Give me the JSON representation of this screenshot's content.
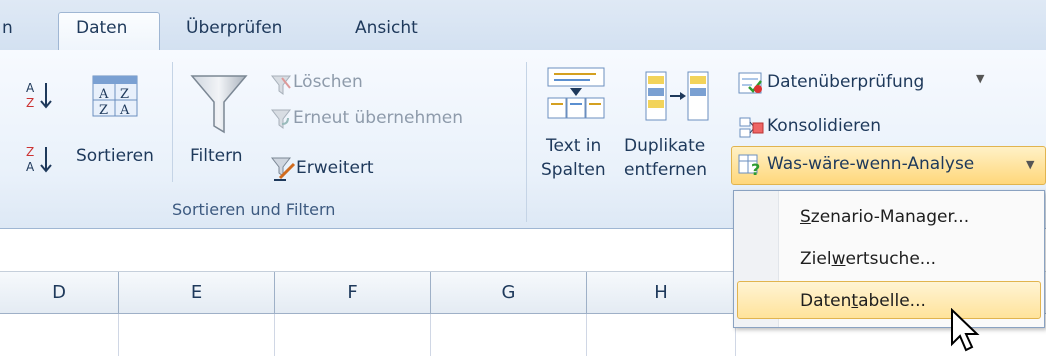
{
  "tabs": {
    "partial": "n",
    "daten": "Daten",
    "ueberpruefen": "Überprüfen",
    "ansicht": "Ansicht"
  },
  "ribbon": {
    "sort_az_glyph": "A↓\nZ",
    "sortieren_label": "Sortieren",
    "filtern_label": "Filtern",
    "loeschen_label": "Löschen",
    "erneut_label": "Erneut übernehmen",
    "erweitert_label": "Erweitert",
    "group_sort_filter": "Sortieren und Filtern",
    "text_in_spalten_line1": "Text in",
    "text_in_spalten_line2": "Spalten",
    "duplikate_line1": "Duplikate",
    "duplikate_line2": "entfernen",
    "datenueberpruefung_label": "Datenüberprüfung",
    "konsolidieren_label": "Konsolidieren",
    "was_waere_wenn_label": "Was-wäre-wenn-Analyse"
  },
  "menu": {
    "szenario_pre": "",
    "szenario_u": "S",
    "szenario_post": "zenario-Manager...",
    "ziel_pre": "Ziel",
    "ziel_u": "w",
    "ziel_post": "ertsuche...",
    "daten_pre": "Daten",
    "daten_u": "t",
    "daten_post": "abelle..."
  },
  "columns": [
    "D",
    "E",
    "F",
    "G",
    "H"
  ],
  "colors": {
    "tab_text": "#1e395b",
    "highlight": "#ffd77b",
    "highlight_border": "#e1b44f"
  }
}
